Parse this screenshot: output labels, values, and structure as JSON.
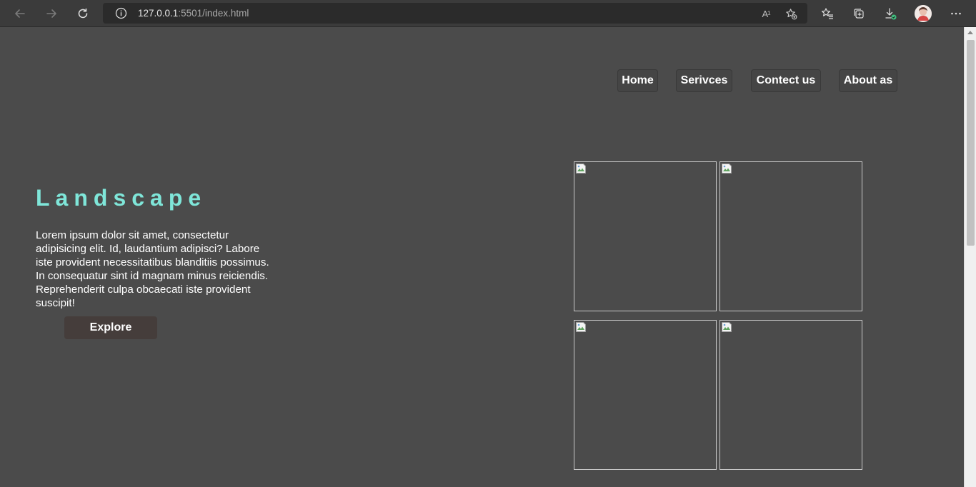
{
  "browser": {
    "url_host": "127.0.0.1",
    "url_rest": ":5501/index.html",
    "read_aloud_label": "A¹",
    "icons": {
      "back": "arrow-left-icon",
      "forward": "arrow-right-icon",
      "refresh": "refresh-icon",
      "info": "info-icon",
      "add_favorite": "star-plus-icon",
      "favorites": "favorites-icon",
      "collections": "collections-icon",
      "downloads": "download-icon",
      "more": "ellipsis-icon"
    }
  },
  "nav": {
    "items": [
      {
        "label": "Home"
      },
      {
        "label": "Serivces"
      },
      {
        "label": "Contect us"
      },
      {
        "label": "About as"
      }
    ]
  },
  "hero": {
    "title": "Landscape",
    "body": "Lorem ipsum dolor sit amet, consectetur adipisicing elit. Id, laudantium adipisci? Labore iste provident necessitatibus blanditiis possimus. In consequatur sint id magnam minus reiciendis. Reprehenderit culpa obcaecati iste provident suscipit!",
    "button_label": "Explore"
  },
  "colors": {
    "background": "#4b4b4b",
    "title_accent": "#7fe6d9",
    "button_bg": "#453d3b",
    "nav_bg": "#454545"
  }
}
